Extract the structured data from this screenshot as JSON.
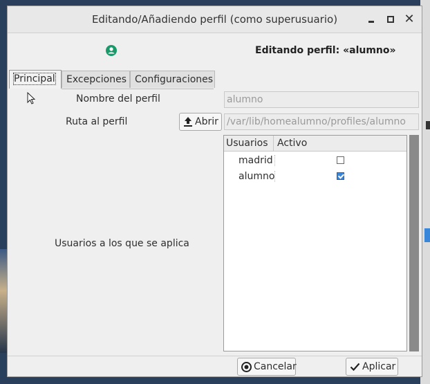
{
  "window": {
    "title": "Editando/Añadiendo perfil (como superusuario)",
    "close_glyph": "✕"
  },
  "header": {
    "icon": "user-circle-icon",
    "title": "Editando perfil: «alumno»"
  },
  "tabs": [
    {
      "label": "Principal",
      "active": true
    },
    {
      "label": "Excepciones",
      "active": false
    },
    {
      "label": "Configuraciones",
      "active": false
    }
  ],
  "form": {
    "profile_name_label": "Nombre del perfil",
    "profile_name_value": "alumno",
    "path_label": "Ruta al perfil",
    "open_button_label": "Abrir",
    "path_value": "/var/lib/homealumno/profiles/alumno",
    "users_label": "Usuarios a los que se aplica"
  },
  "users_table": {
    "columns": [
      "Usuarios",
      "Activo"
    ],
    "rows": [
      {
        "user": "madrid",
        "active": false
      },
      {
        "user": "alumno",
        "active": true
      }
    ]
  },
  "footer": {
    "cancel_label": "Cancelar",
    "apply_label": "Aplicar"
  },
  "colors": {
    "accent": "#3a86d8",
    "icon_green": "#1a9a6a"
  }
}
